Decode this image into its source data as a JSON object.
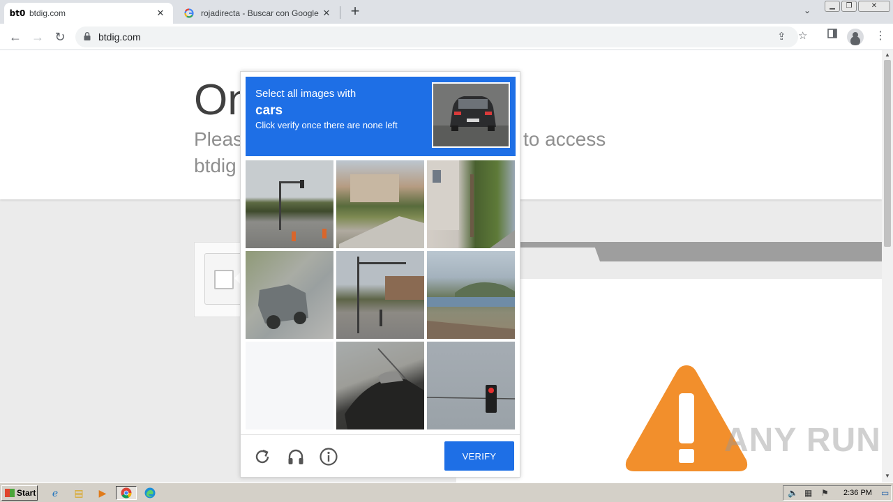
{
  "browser": {
    "tabs": [
      {
        "favicon_text": "bt0",
        "title": "btdig.com",
        "active": true
      },
      {
        "favicon": "google-g-icon",
        "title": "rojadirecta - Buscar con Google",
        "active": false
      }
    ],
    "new_tab": "+",
    "url": "btdig.com",
    "accent": "#1a73e8"
  },
  "page": {
    "heading": "On",
    "subtitle_line1": "Pleas",
    "subtitle_line2": "btdig",
    "subtitle_right": "to access",
    "watermark": "ANY RUN"
  },
  "captcha": {
    "prompt": "Select all images with",
    "target_word": "cars",
    "hint": "Click verify once there are none left",
    "verify_label": "VERIFY",
    "accent": "#1e6fe6",
    "tiles": [
      "traffic-light-road-tile",
      "house-lawn-tile",
      "palm-building-tile",
      "pickup-truck-tile",
      "street-pole-tile",
      "coast-hill-tile",
      "blank-tile",
      "car-closeup-tile",
      "red-traffic-light-tile"
    ]
  },
  "taskbar": {
    "start_label": "Start",
    "clock": "2:36 PM"
  }
}
